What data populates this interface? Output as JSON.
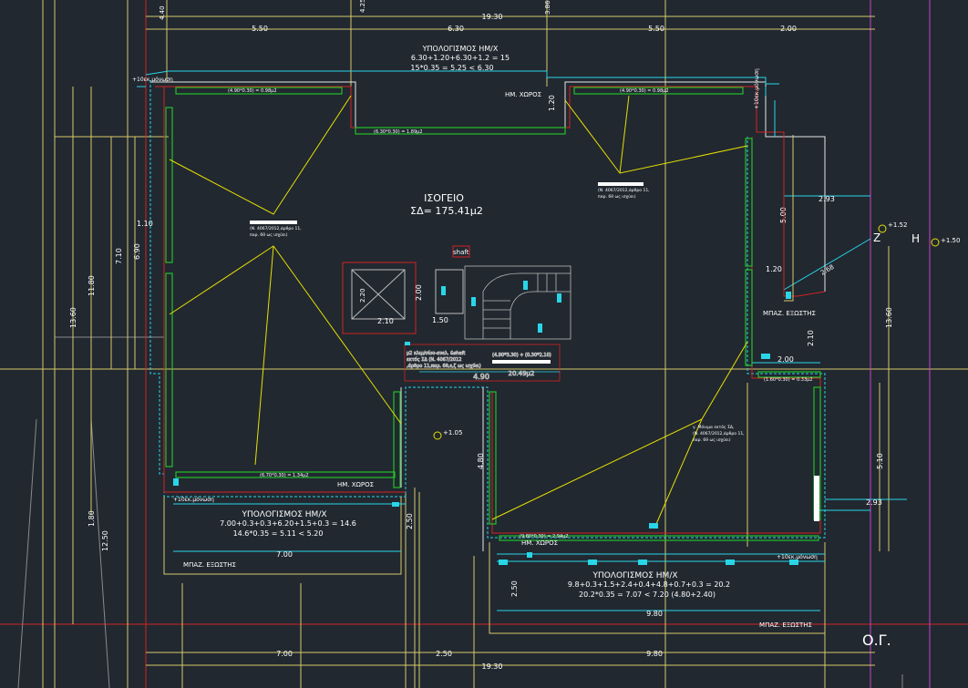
{
  "plan": {
    "title": "ΙΣΟΓΕΙΟ",
    "area": "ΣΔ= 175.41μ2",
    "og": "Ο.Γ.",
    "point_z": "Ζ",
    "point_h": "Η"
  },
  "dims": {
    "top_total": "19.30",
    "top_left": "5.50",
    "top_mid": "6.30",
    "top_mid2": "5.50",
    "top_right": "2.00",
    "bottom_left": "7.00",
    "bottom_mid": "2.50",
    "bottom_right": "9.80",
    "bottom_total": "19.30",
    "left_total": "13.60",
    "left_11": "11.80",
    "left_710": "7.10",
    "left_690": "6.90",
    "left_110": "1.10",
    "left_180": "1.80",
    "left_1250": "12.50",
    "right_1360": "13.60",
    "right_510": "5.10",
    "right_293a": "2.93",
    "right_293b": "2.93",
    "right_500": "5.00",
    "right_120": "1.20",
    "right_210": "2.10",
    "right_200": "2.00",
    "right_268": "2.68",
    "stair_490": "4.90",
    "shaft_210": "2.10",
    "shaft_220": "2.20",
    "shaft_200": "2.00",
    "shaft_150": "1.50",
    "stair_area": "20.49μ2",
    "top_425": "4.25",
    "top_440": "4.40",
    "top_386": "3.86",
    "b_700": "7.00",
    "b_250": "2.50",
    "b_980": "9.80",
    "mid_480": "4.80",
    "mid_250": "2.50",
    "top_120": "1.20",
    "lvl_152": "+1.52",
    "lvl_150": "+1.50",
    "lvl_105": "+1.05"
  },
  "labels": {
    "calc_top_title": "ΥΠΟΛΟΓΙΣΜΟΣ ΗΜ/Χ",
    "calc_top_l1": "6.30+1.20+6.30+1.2 = 15",
    "calc_top_l2": "15*0.35 = 5.25 < 6.30",
    "calc_left_title": "ΥΠΟΛΟΓΙΣΜΟΣ ΗΜ/Χ",
    "calc_left_l1": "7.00+0.3+0.3+6.20+1.5+0.3 = 14.6",
    "calc_left_l2": "14.6*0.35 = 5.11 < 5.20",
    "calc_right_title": "ΥΠΟΛΟΓΙΣΜΟΣ ΗΜ/Χ",
    "calc_right_l1": "9.8+0.3+1.5+2.4+0.4+4.8+0.7+0.3 = 20.2",
    "calc_right_l2": "20.2*0.35 = 7.07 < 7.20 (4.80+2.40)",
    "hm_top": "ΗΜ. ΧΩΡΟΣ",
    "hm_left": "ΗΜ. ΧΩΡΟΣ",
    "hm_right": "ΗΜ. ΧΩΡΟΣ",
    "mpaz_left": "ΜΠΑΖ. ΕΞΩΣΤΗΣ",
    "mpaz_right": "ΜΠΑΖ. ΕΞΩΣΤΗΣ",
    "mpaz_bottom": "ΜΠΑΖ. ΕΞΩΣΤΗΣ",
    "ins_top": "+10εκ.μόνωση",
    "ins_left": "+10εκ.μόνωση",
    "ins_right": "+10εκ.μόνωση",
    "ins_right_top": "+10εκ.μόνωση",
    "shaft": "shaft",
    "stair_note": "(4.90*3.30) + (0.30*2.10)",
    "note1": "(Ν. 4067/2012,άρθρο 11,",
    "note2": "παρ. 6θ ως ισχύει)",
    "note3": "(Ν. 4067/2012,άρθρο 11,",
    "note4": "παρ. 6θ ως ισχύει)",
    "note5": "γ. Μόνιμα εκτός ΣΔ,",
    "note6": "(Ν. 4067/2012,άρθρο 11,",
    "note7": "παρ. 6θ ως ισχύει)",
    "stair_exc1": "μ2 κλιμ/σίου-ανελ. &shaft",
    "stair_exc2": "εκτός ΣΔ (Ν. 4067/2012",
    "stair_exc3": ",άρθρο 11,παρ. 6θ,ε,ζ ως ισχύει)",
    "win_top_l": "(4.90*0.30) = 0.98μ2",
    "win_top_r": "(4.90*0.30) = 0.98μ2",
    "win_top_mid": "(6.30*0.30) = 1.89μ2",
    "win_left_bot": "(6.70*0.30) = 1.34μ2",
    "win_right_bot": "(9.80*0.30) = 2.94μ2",
    "win_right_mid": "(1.60*0.30) = 0.33μ2"
  }
}
